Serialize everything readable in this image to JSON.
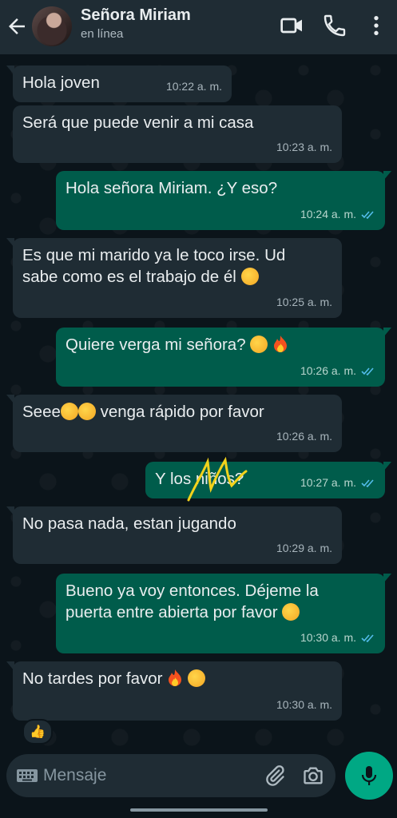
{
  "header": {
    "contact_name": "Señora Miriam",
    "status": "en línea",
    "icons": [
      "back-arrow-icon",
      "video-call-icon",
      "phone-icon",
      "more-options-icon"
    ]
  },
  "messages": [
    {
      "dir": "in",
      "text": "Hola joven",
      "time": "10:22 a. m."
    },
    {
      "dir": "in",
      "text": "Será que puede venir a mi casa",
      "time": "10:23 a. m."
    },
    {
      "dir": "out",
      "text": "Hola señora Miriam. ¿Y eso?",
      "time": "10:24 a. m.",
      "status": "read"
    },
    {
      "dir": "in",
      "text": "Es que mi marido ya le toco irse. Ud\nsabe como es el trabajo de él",
      "emoji_after": "pleading-face-emoji",
      "time": "10:25 a. m."
    },
    {
      "dir": "out",
      "text": "Quiere verga mi señora?",
      "emoji_after": "relieved-face-emoji fire-emoji",
      "time": "10:26 a. m.",
      "status": "read"
    },
    {
      "dir": "in",
      "text": "venga rápido por favor",
      "prefix": "Seee",
      "emoji_between": "smiling-face-emoji smiling-face-emoji",
      "time": "10:26 a. m."
    },
    {
      "dir": "out",
      "text": "Y los niños?",
      "time": "10:27 a. m.",
      "status": "read"
    },
    {
      "dir": "in",
      "text": "No pasa nada, estan jugando",
      "time": "10:29 a. m."
    },
    {
      "dir": "out",
      "text": "Bueno ya voy entonces. Déjeme la\npuerta entre abierta por favor",
      "emoji_after": "kissing-face-emoji",
      "time": "10:30 a. m.",
      "status": "read"
    },
    {
      "dir": "in",
      "text": "No tardes por favor",
      "emoji_after": "fire-emoji face-with-hand-over-mouth-emoji",
      "time": "10:30 a. m."
    }
  ],
  "reaction": "👍",
  "composer": {
    "placeholder": "Mensaje",
    "icons": [
      "keyboard-icon",
      "attach-icon",
      "camera-icon",
      "mic-icon"
    ]
  },
  "colors": {
    "background": "#0b141a",
    "header": "#1f2c34",
    "incoming_bubble": "#1f2c34",
    "outgoing_bubble": "#005c4b",
    "accent": "#00a884",
    "read_ticks": "#53bdeb",
    "scribble": "#f2d21b"
  }
}
